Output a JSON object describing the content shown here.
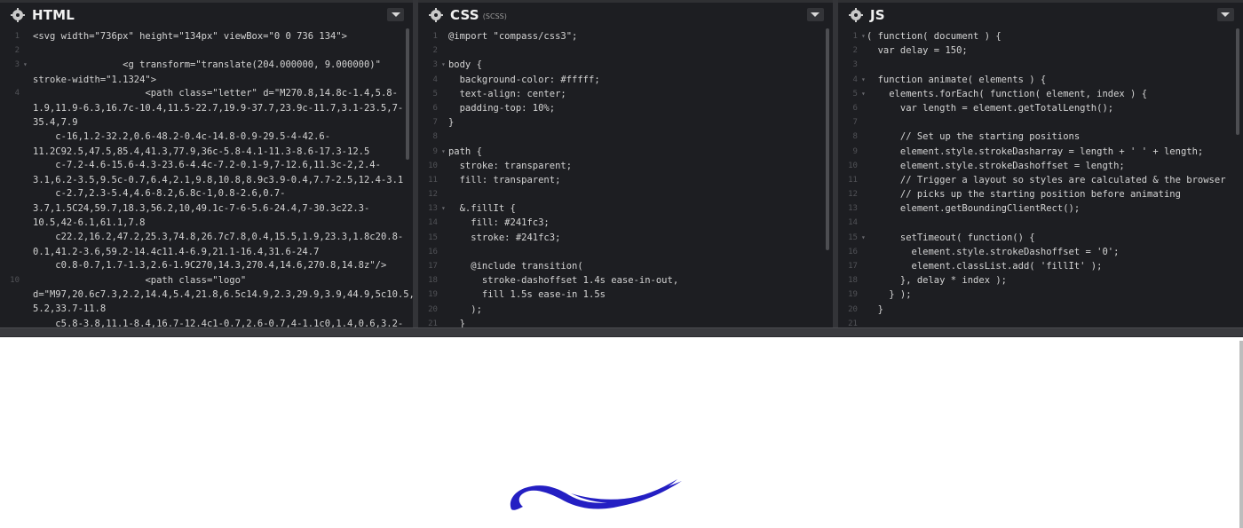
{
  "panels": {
    "html": {
      "title": "HTML",
      "lines": [
        {
          "n": "1",
          "fold": "",
          "text": "<svg width=\"736px\" height=\"134px\" viewBox=\"0 0 736 134\">"
        },
        {
          "n": "2",
          "fold": "",
          "text": ""
        },
        {
          "n": "3",
          "fold": "▾",
          "text": "                <g transform=\"translate(204.000000, 9.000000)\" stroke-width=\"1.1324\">"
        },
        {
          "n": "4",
          "fold": "",
          "text": "                    <path class=\"letter\" d=\"M270.8,14.8c-1.4,5.8-1.9,11.9-6.3,16.7c-10.4,11.5-22.7,19.9-37.7,23.9c-11.7,3.1-23.5,7-35.4,7.9"
        },
        {
          "n": "",
          "fold": "",
          "text": "    c-16,1.2-32.2,0.6-48.2-0.4c-14.8-0.9-29.5-4-42.6-11.2C92.5,47.5,85.4,41.3,77.9,36c-5.8-4.1-11.3-8.6-17.3-12.5"
        },
        {
          "n": "",
          "fold": "",
          "text": "    c-7.2-4.6-15.6-4.3-23.6-4.4c-7.2-0.1-9,7-12.6,11.3c-2,2.4-3.1,6.2-3.5,9.5c-0.7,6.4,2.1,9.8,10.8,8.9c3.9-0.4,7.7-2.5,12.4-3.1"
        },
        {
          "n": "",
          "fold": "",
          "text": "    c-2.7,2.3-5.4,4.6-8.2,6.8c-1,0.8-2.6,0.7-3.7,1.5C24,59.7,18.3,56.2,10,49.1c-7-6-5.6-24.4,7-30.3c22.3-10.5,42-6.1,61.1,7.8"
        },
        {
          "n": "",
          "fold": "",
          "text": "    c22.2,16.2,47.2,25.3,74.8,26.7c7.8,0.4,15.5,1.9,23.3,1.8c20.8-0.1,41.2-3.6,59.2-14.4c11.4-6.9,21.1-16.4,31.6-24.7"
        },
        {
          "n": "",
          "fold": "",
          "text": "    c0.8-0.7,1.7-1.3,2.6-1.9C270,14.3,270.4,14.6,270.8,14.8z\"/>"
        },
        {
          "n": "10",
          "fold": "",
          "text": "                    <path class=\"logo\" d=\"M97,20.6c7.3,2.2,14.4,5.4,21.8,6.5c14.9,2.3,29.9,3.9,44.9,5c10.5,0.8,21.2,0,31.8,0.2c12.8,0.3,23.5-5.2,33.7-11.8"
        },
        {
          "n": "",
          "fold": "",
          "text": "    c5.8-3.8,11.1-8.4,16.7-12.4c1-0.7,2.6-0.7,4-1.1c0,1.4,0.6,3.2-"
        }
      ]
    },
    "css": {
      "title": "CSS",
      "subtitle": "(SCSS)",
      "lines": [
        {
          "n": "1",
          "fold": "",
          "text": "@import \"compass/css3\";"
        },
        {
          "n": "2",
          "fold": "",
          "text": ""
        },
        {
          "n": "3",
          "fold": "▾",
          "text": "body {"
        },
        {
          "n": "4",
          "fold": "",
          "text": "  background-color: #fffff;"
        },
        {
          "n": "5",
          "fold": "",
          "text": "  text-align: center;"
        },
        {
          "n": "6",
          "fold": "",
          "text": "  padding-top: 10%;"
        },
        {
          "n": "7",
          "fold": "",
          "text": "}"
        },
        {
          "n": "8",
          "fold": "",
          "text": ""
        },
        {
          "n": "9",
          "fold": "▾",
          "text": "path {"
        },
        {
          "n": "10",
          "fold": "",
          "text": "  stroke: transparent;"
        },
        {
          "n": "11",
          "fold": "",
          "text": "  fill: transparent;"
        },
        {
          "n": "12",
          "fold": "",
          "text": ""
        },
        {
          "n": "13",
          "fold": "▾",
          "text": "  &.fillIt {"
        },
        {
          "n": "14",
          "fold": "",
          "text": "    fill: #241fc3;"
        },
        {
          "n": "15",
          "fold": "",
          "text": "    stroke: #241fc3;"
        },
        {
          "n": "16",
          "fold": "",
          "text": ""
        },
        {
          "n": "17",
          "fold": "",
          "text": "    @include transition("
        },
        {
          "n": "18",
          "fold": "",
          "text": "      stroke-dashoffset 1.4s ease-in-out,"
        },
        {
          "n": "19",
          "fold": "",
          "text": "      fill 1.5s ease-in 1.5s"
        },
        {
          "n": "20",
          "fold": "",
          "text": "    );"
        },
        {
          "n": "21",
          "fold": "",
          "text": "  }"
        }
      ]
    },
    "js": {
      "title": "JS",
      "lines": [
        {
          "n": "1",
          "fold": "▾",
          "text": "( function( document ) {"
        },
        {
          "n": "2",
          "fold": "",
          "text": "  var delay = 150;"
        },
        {
          "n": "3",
          "fold": "",
          "text": ""
        },
        {
          "n": "4",
          "fold": "▾",
          "text": "  function animate( elements ) {"
        },
        {
          "n": "5",
          "fold": "▾",
          "text": "    elements.forEach( function( element, index ) {"
        },
        {
          "n": "6",
          "fold": "",
          "text": "      var length = element.getTotalLength();"
        },
        {
          "n": "7",
          "fold": "",
          "text": ""
        },
        {
          "n": "8",
          "fold": "",
          "text": "      // Set up the starting positions"
        },
        {
          "n": "9",
          "fold": "",
          "text": "      element.style.strokeDasharray = length + ' ' + length;"
        },
        {
          "n": "10",
          "fold": "",
          "text": "      element.style.strokeDashoffset = length;"
        },
        {
          "n": "11",
          "fold": "",
          "text": "      // Trigger a layout so styles are calculated & the browser"
        },
        {
          "n": "12",
          "fold": "",
          "text": "      // picks up the starting position before animating"
        },
        {
          "n": "13",
          "fold": "",
          "text": "      element.getBoundingClientRect();"
        },
        {
          "n": "14",
          "fold": "",
          "text": ""
        },
        {
          "n": "15",
          "fold": "▾",
          "text": "      setTimeout( function() {"
        },
        {
          "n": "16",
          "fold": "",
          "text": "        element.style.strokeDashoffset = '0';"
        },
        {
          "n": "17",
          "fold": "",
          "text": "        element.classList.add( 'fillIt' );"
        },
        {
          "n": "18",
          "fold": "",
          "text": "      }, delay * index );"
        },
        {
          "n": "19",
          "fold": "",
          "text": "    } );"
        },
        {
          "n": "20",
          "fold": "",
          "text": "  }"
        },
        {
          "n": "21",
          "fold": "",
          "text": ""
        }
      ]
    }
  },
  "colors": {
    "editor_bg": "#1d1e22",
    "preview_logo_fill": "#241fc3",
    "code_text": "#d4d4d4",
    "line_numbers": "#515257"
  },
  "icons": {
    "settings": "gear-icon",
    "collapse": "chevron-down-icon"
  }
}
